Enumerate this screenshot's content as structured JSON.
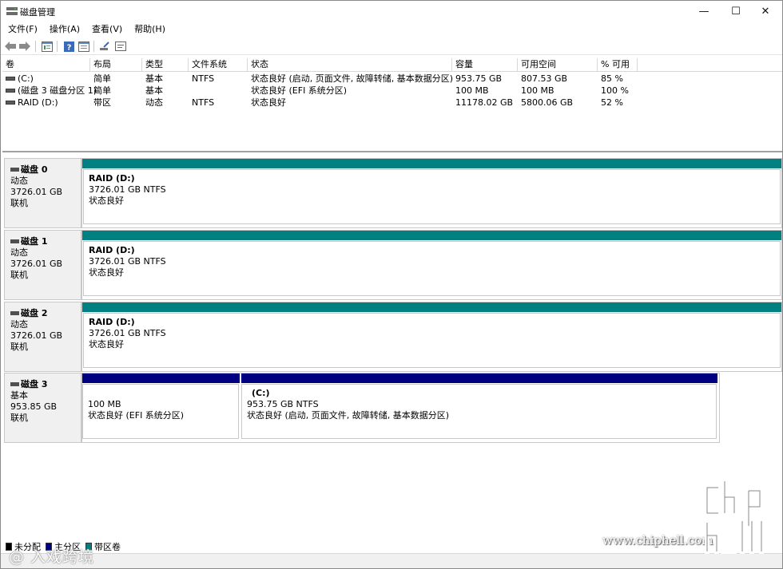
{
  "window": {
    "title": "磁盘管理",
    "minimize": "—",
    "maximize": "☐",
    "close": "✕"
  },
  "menu": [
    "文件(F)",
    "操作(A)",
    "查看(V)",
    "帮助(H)"
  ],
  "toolbar_icons": [
    "back-icon",
    "forward-icon",
    "properties-icon",
    "help-icon",
    "rescan-icon",
    "settings-icon"
  ],
  "volume_table": {
    "headers": [
      "卷",
      "布局",
      "类型",
      "文件系统",
      "状态",
      "容量",
      "可用空间",
      "% 可用"
    ],
    "rows": [
      [
        "(C:)",
        "简单",
        "基本",
        "NTFS",
        "状态良好 (启动, 页面文件, 故障转储, 基本数据分区)",
        "953.75 GB",
        "807.53 GB",
        "85 %"
      ],
      [
        "(磁盘 3 磁盘分区 1)",
        "简单",
        "基本",
        "",
        "状态良好 (EFI 系统分区)",
        "100 MB",
        "100 MB",
        "100 %"
      ],
      [
        "RAID (D:)",
        "带区",
        "动态",
        "NTFS",
        "状态良好",
        "11178.02 GB",
        "5800.06 GB",
        "52 %"
      ]
    ]
  },
  "disks": [
    {
      "name": "磁盘 0",
      "type": "动态",
      "size": "3726.01 GB",
      "status": "联机",
      "partitions": [
        {
          "name": "RAID  (D:)",
          "size": "3726.01 GB NTFS",
          "status": "状态良好",
          "kind": "striped"
        }
      ]
    },
    {
      "name": "磁盘 1",
      "type": "动态",
      "size": "3726.01 GB",
      "status": "联机",
      "partitions": [
        {
          "name": "RAID  (D:)",
          "size": "3726.01 GB NTFS",
          "status": "状态良好",
          "kind": "striped"
        }
      ]
    },
    {
      "name": "磁盘 2",
      "type": "动态",
      "size": "3726.01 GB",
      "status": "联机",
      "partitions": [
        {
          "name": "RAID  (D:)",
          "size": "3726.01 GB NTFS",
          "status": "状态良好",
          "kind": "striped"
        }
      ]
    },
    {
      "name": "磁盘 3",
      "type": "基本",
      "size": "953.85 GB",
      "status": "联机",
      "partitions": [
        {
          "name": "",
          "size": "100 MB",
          "status": "状态良好 (EFI 系统分区)",
          "kind": "primary"
        },
        {
          "name": "(C:)",
          "size": "953.75 GB NTFS",
          "status": "状态良好 (启动, 页面文件, 故障转储, 基本数据分区)",
          "kind": "primary"
        }
      ]
    }
  ],
  "legend": [
    {
      "label": "未分配",
      "color": "#000000"
    },
    {
      "label": "主分区",
      "color": "#000080"
    },
    {
      "label": "带区卷",
      "color": "#008080"
    }
  ],
  "colors": {
    "striped": "#008080",
    "primary": "#000080"
  },
  "watermarks": {
    "left": "@ 入戏跨境",
    "url": "www.chiphell.com"
  }
}
